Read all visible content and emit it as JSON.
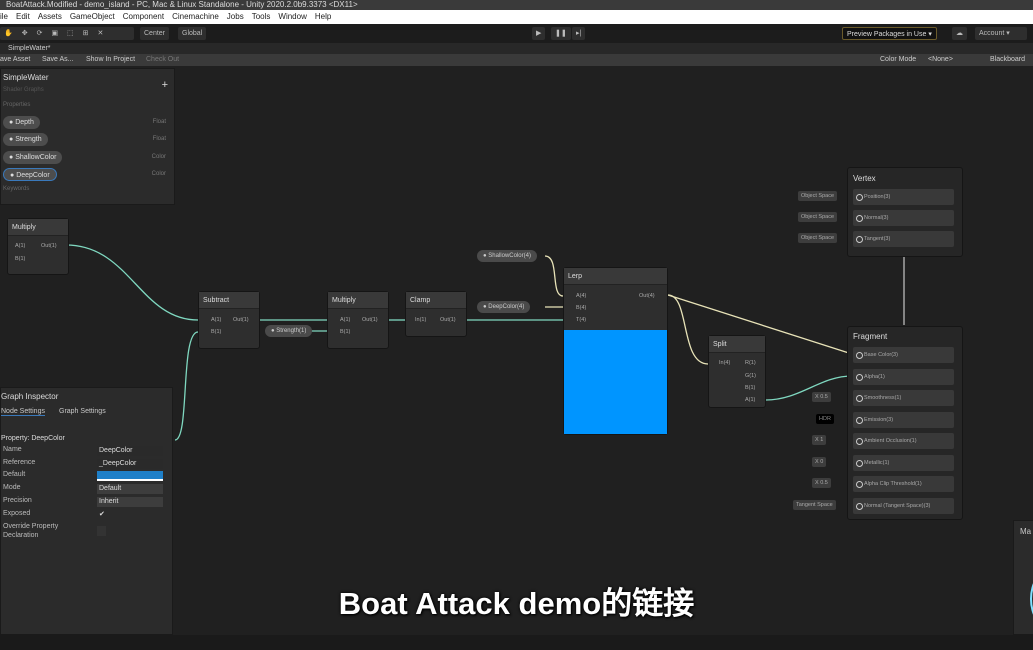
{
  "window": {
    "title": "BoatAttack.Modified - demo_island - PC, Mac & Linux Standalone - Unity 2020.2.0b9.3373 <DX11>"
  },
  "menu": [
    "ile",
    "Edit",
    "Assets",
    "GameObject",
    "Component",
    "Cinemachine",
    "Jobs",
    "Tools",
    "Window",
    "Help"
  ],
  "toolbar": {
    "center": "Center",
    "global": "Global",
    "preview_packages": "Preview Packages in Use",
    "account": "Account"
  },
  "tab": {
    "label": "SimpleWater*"
  },
  "sg_toolbar": {
    "save_asset": "ave Asset",
    "save_as": "Save As...",
    "show_in_project": "Show In Project",
    "check_out": "Check Out",
    "color_mode_label": "Color Mode",
    "color_mode_value": "<None>",
    "blackboard": "Blackboard"
  },
  "blackboard": {
    "title": "SimpleWater",
    "subtitle": "Shader Graphs",
    "section": "Properties",
    "add": "+",
    "properties": [
      {
        "name": "Depth",
        "type": "Float"
      },
      {
        "name": "Strength",
        "type": "Float"
      },
      {
        "name": "ShallowColor",
        "type": "Color"
      },
      {
        "name": "DeepColor",
        "type": "Color"
      }
    ],
    "keywords": "Keywords"
  },
  "inspector": {
    "title": "Graph Inspector",
    "tabs": [
      "Node Settings",
      "Graph Settings"
    ],
    "heading": "Property: DeepColor",
    "fields": [
      {
        "label": "Name",
        "value": "DeepColor"
      },
      {
        "label": "Reference",
        "value": "_DeepColor"
      },
      {
        "label": "Default",
        "value": ""
      },
      {
        "label": "Mode",
        "value": "Default"
      },
      {
        "label": "Precision",
        "value": "Inherit"
      },
      {
        "label": "Exposed",
        "value": "✔"
      },
      {
        "label": "Override Property Declaration",
        "value": ""
      }
    ],
    "default_color": "#1e7fc8"
  },
  "nodes": {
    "multiply1": {
      "title": "Multiply",
      "in": [
        "A(1)",
        "B(1)"
      ],
      "out": "Out(1)"
    },
    "subtract": {
      "title": "Subtract",
      "in": [
        "A(1)",
        "B(1)"
      ],
      "out": "Out(1)"
    },
    "multiply2": {
      "title": "Multiply",
      "in": [
        "A(1)",
        "B(1)"
      ],
      "out": "Out(1)"
    },
    "clamp": {
      "title": "Clamp",
      "in": [
        "In(1)"
      ],
      "out": "Out(1)"
    },
    "lerp": {
      "title": "Lerp",
      "in": [
        "A(4)",
        "B(4)",
        "T(4)"
      ],
      "out": "Out(4)",
      "preview_color": "#0095ff"
    },
    "split": {
      "title": "Split",
      "in": [
        "In(4)"
      ],
      "out": [
        "R(1)",
        "G(1)",
        "B(1)",
        "A(1)"
      ]
    }
  },
  "pills": {
    "shallow": "ShallowColor(4)",
    "deep": "DeepColor(4)",
    "strength": "Strength(1)"
  },
  "vertex": {
    "title": "Vertex",
    "slots": [
      {
        "label": "Position(3)",
        "input": "Object Space"
      },
      {
        "label": "Normal(3)",
        "input": "Object Space"
      },
      {
        "label": "Tangent(3)",
        "input": "Object Space"
      }
    ]
  },
  "fragment": {
    "title": "Fragment",
    "slots": [
      {
        "label": "Base Color(3)",
        "input": ""
      },
      {
        "label": "Alpha(1)",
        "input": ""
      },
      {
        "label": "Smoothness(1)",
        "input": "X  0.5"
      },
      {
        "label": "Emission(3)",
        "input": "HDR"
      },
      {
        "label": "Ambient Occlusion(1)",
        "input": "X  1"
      },
      {
        "label": "Metallic(1)",
        "input": "X  0"
      },
      {
        "label": "Alpha Clip Threshold(1)",
        "input": "X  0.5"
      },
      {
        "label": "Normal (Tangent Space)(3)",
        "input": "Tangent Space"
      }
    ]
  },
  "main_preview": {
    "title": "Ma"
  },
  "subtitle": "Boat Attack demo的链接",
  "colors": {
    "edge": "#7fd8c0",
    "edge_color": "#e8e3b8",
    "canvas": "#202020"
  }
}
